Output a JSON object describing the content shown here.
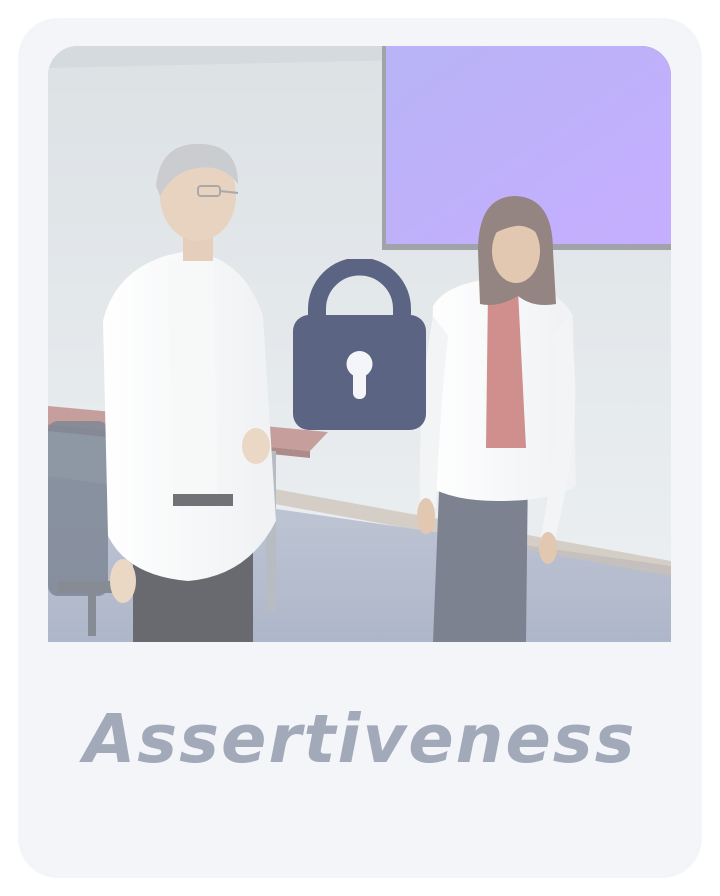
{
  "card": {
    "title": "Assertiveness",
    "locked": true,
    "thumbnail": "two-doctors-in-meeting-room-scene",
    "lock_icon": "padlock-icon"
  },
  "colors": {
    "card_bg": "#f3f5f9",
    "title": "#a2a9b9",
    "lock": "#5c6483",
    "screen": "#a48cff"
  }
}
